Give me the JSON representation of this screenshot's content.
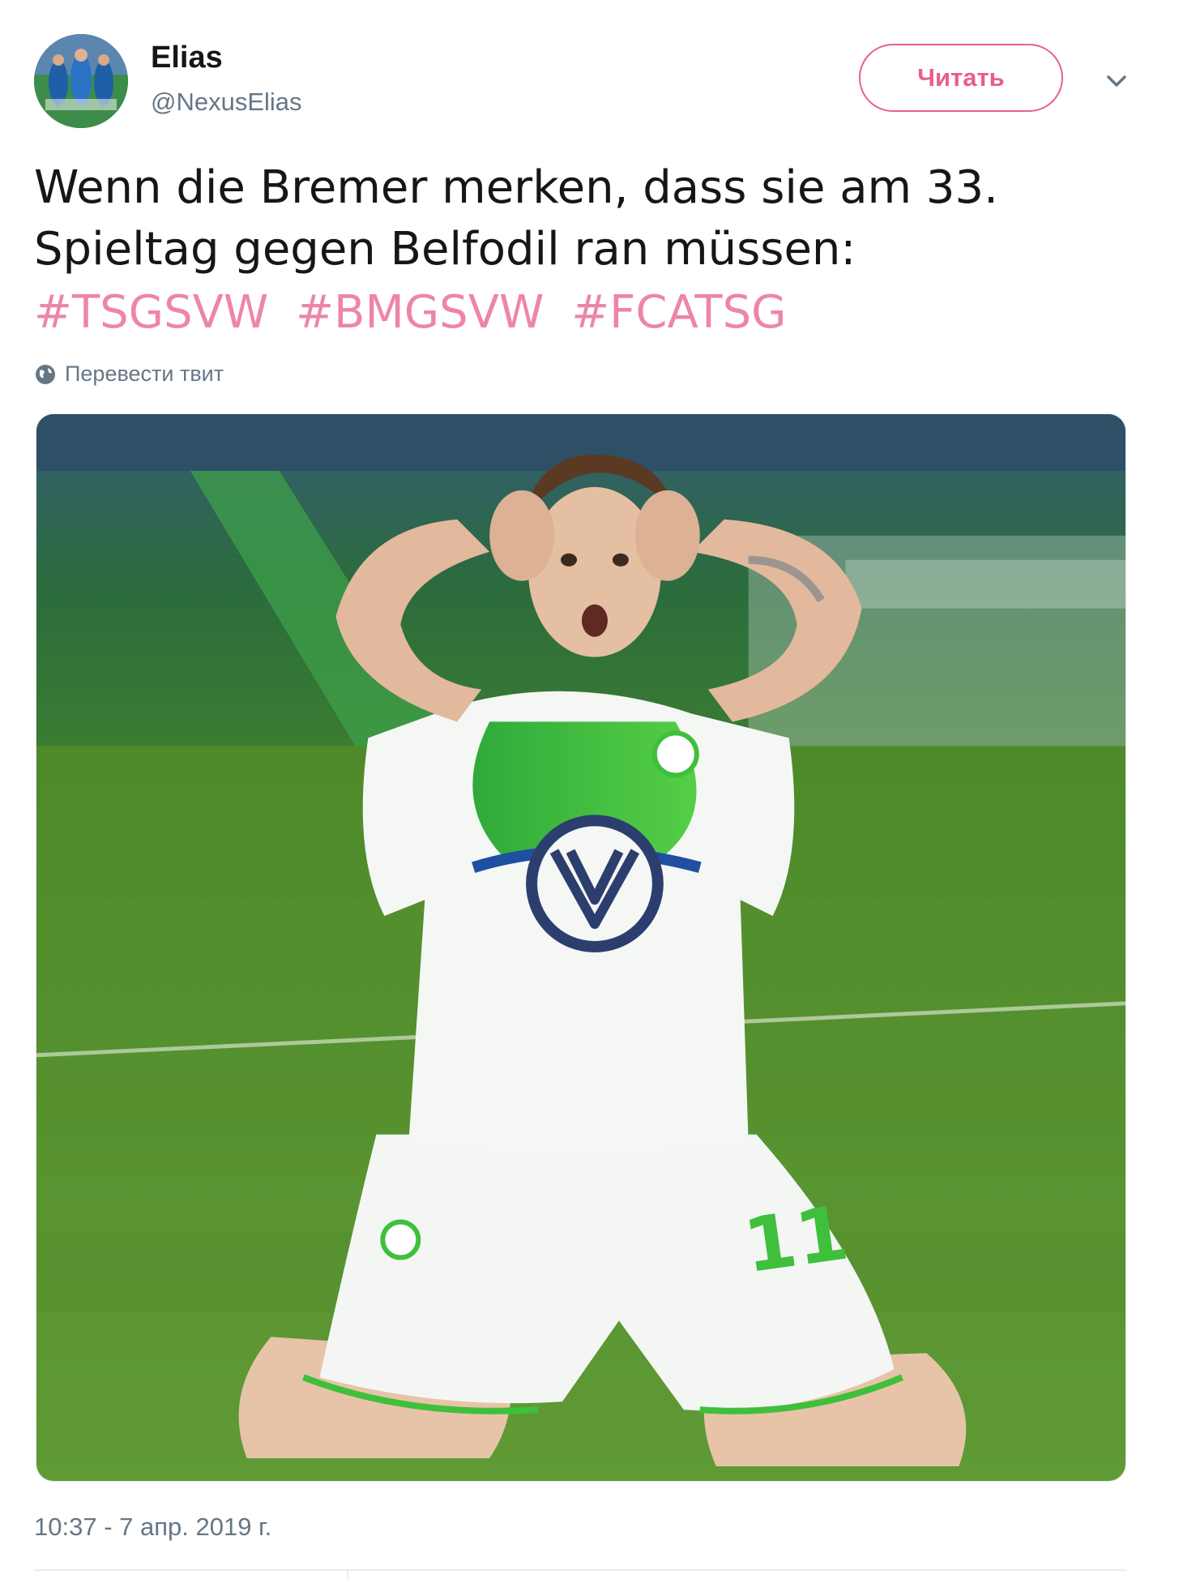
{
  "user": {
    "name": "Elias",
    "handle": "@NexusElias"
  },
  "follow_button": {
    "label": "Читать"
  },
  "tweet": {
    "text": "Wenn die Bremer merken, dass sie am 33. Spieltag gegen Belfodil ran müssen:",
    "hashtags": [
      "#TSGSVW",
      "#BMGSVW",
      "#FCATSG"
    ]
  },
  "translate": {
    "label": "Перевести твит"
  },
  "media": {
    "jersey_number": "11"
  },
  "footer": {
    "timestamp": "10:37 - 7 апр. 2019 г."
  },
  "colors": {
    "accent": "#e0245e",
    "text": "#14171a",
    "secondary": "#657786",
    "pitch": "#4f8a2c",
    "kit_green": "#3fbf3b"
  },
  "icons": [
    "chevron-down-icon",
    "globe-icon"
  ]
}
